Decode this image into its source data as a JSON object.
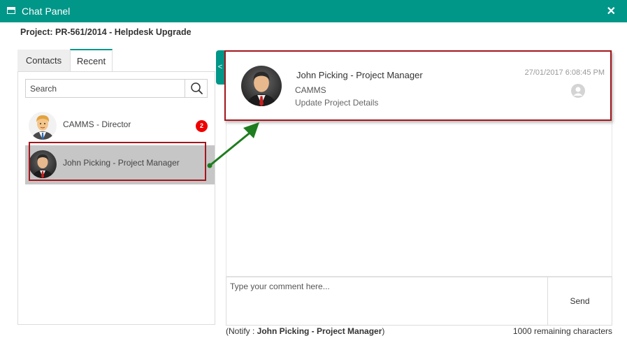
{
  "window": {
    "title": "Chat Panel",
    "close_label": "✕"
  },
  "project": {
    "title": "Project: PR-561/2014 - Helpdesk Upgrade"
  },
  "tabs": [
    {
      "label": "Contacts",
      "active": false
    },
    {
      "label": "Recent",
      "active": true
    }
  ],
  "search": {
    "placeholder": "Search",
    "icon": "search-icon"
  },
  "contacts": [
    {
      "name": "CAMMS - Director",
      "avatar": "director-avatar",
      "unread": "2",
      "selected": false
    },
    {
      "name": "John Picking - Project Manager",
      "avatar": "manager-avatar",
      "selected": true
    }
  ],
  "collapse_handle": "<",
  "message": {
    "sender": "John Picking - Project Manager",
    "timestamp": "27/01/2017 6:08:45 PM",
    "org": "CAMMS",
    "subject": "Update Project Details",
    "status_icon": "user-read-icon"
  },
  "composer": {
    "placeholder": "Type your comment here...",
    "send_label": "Send",
    "notify_prefix": "(Notify : ",
    "notify_name": "John Picking - Project Manager",
    "notify_suffix": ")",
    "remaining": "1000 remaining characters"
  },
  "colors": {
    "titlebar": "#009688",
    "highlight": "#a3161c",
    "arrow": "#1e7d1e",
    "badge": "#e00000",
    "selected_row": "#c6c6c6"
  }
}
